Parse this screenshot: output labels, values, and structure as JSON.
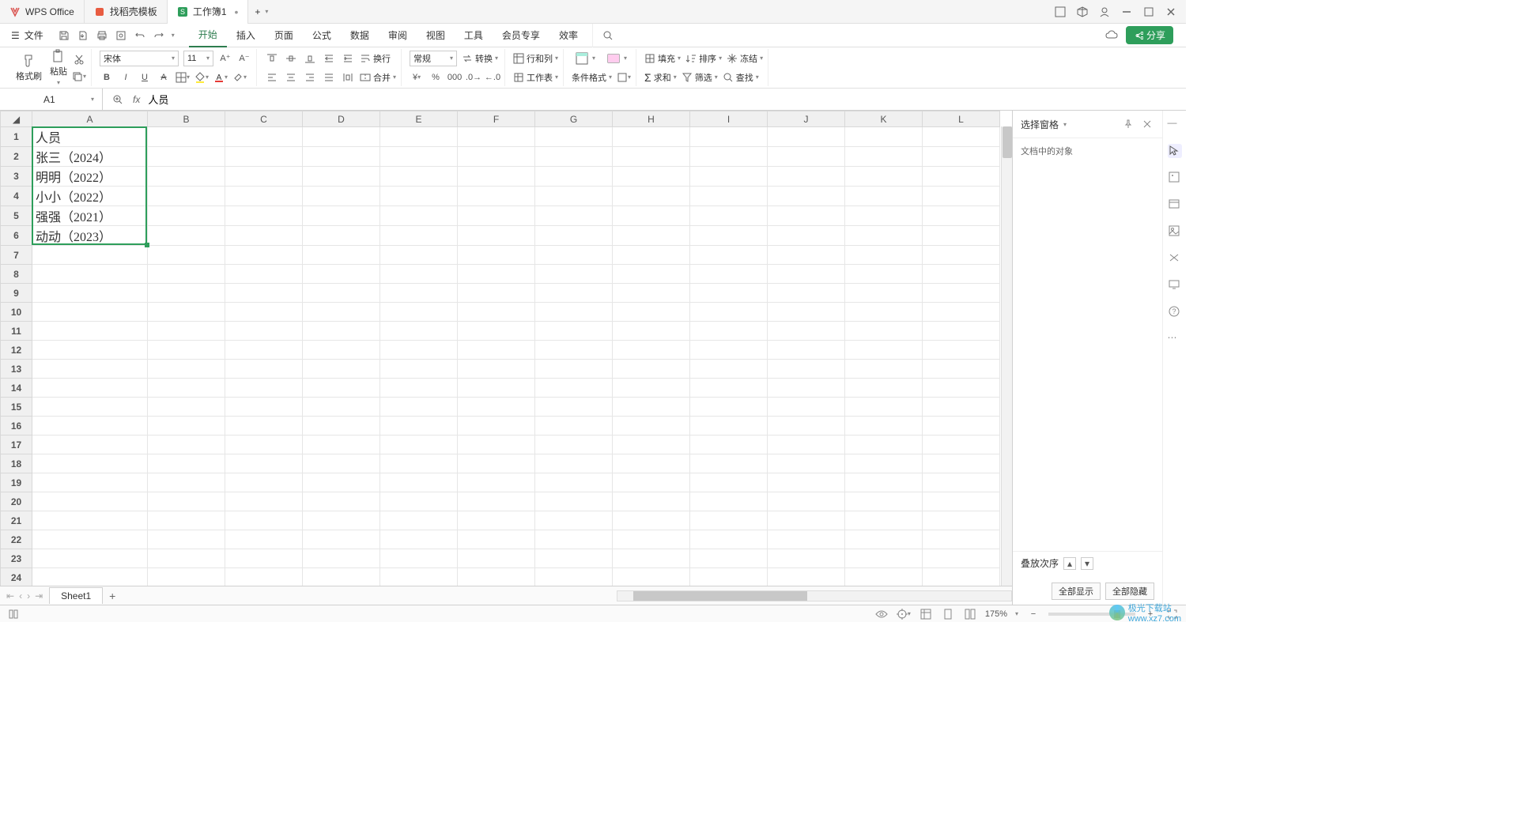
{
  "titlebar": {
    "tabs": [
      {
        "icon": "wps-logo-icon",
        "label": "WPS Office",
        "iconColor": "#d9534f"
      },
      {
        "icon": "template-icon",
        "label": "找稻壳模板",
        "iconColor": "#e85c41"
      },
      {
        "icon": "sheet-icon",
        "label": "工作簿1",
        "iconColor": "#2e9e5b",
        "active": true,
        "dirty": "•"
      }
    ],
    "addTab": "+"
  },
  "menubar": {
    "file": "文件",
    "tabs": [
      "开始",
      "插入",
      "页面",
      "公式",
      "数据",
      "审阅",
      "视图",
      "工具",
      "会员专享",
      "效率"
    ],
    "active": 0,
    "share": "分享"
  },
  "ribbon": {
    "formatBrush": "格式刷",
    "paste": "粘贴",
    "font": "宋体",
    "fontSize": "11",
    "wrap": "换行",
    "merge": "合并",
    "numFmt": "常规",
    "convert": "转换",
    "rowCol": "行和列",
    "worksheet": "工作表",
    "condFmt": "条件格式",
    "fill": "填充",
    "sort": "排序",
    "freeze": "冻结",
    "sum": "求和",
    "filter": "筛选",
    "find": "查找"
  },
  "formula": {
    "nameBox": "A1",
    "value": "人员"
  },
  "grid": {
    "columns": [
      "A",
      "B",
      "C",
      "D",
      "E",
      "F",
      "G",
      "H",
      "I",
      "J",
      "K",
      "L"
    ],
    "rowCount": 24,
    "cells": {
      "A1": "人员",
      "A2": "张三（2024）",
      "A3": "明明（2022）",
      "A4": "小小（2022）",
      "A5": "强强（2021）",
      "A6": "动动（2023）"
    },
    "selection": {
      "col": "A",
      "rowStart": 1,
      "rowEnd": 6
    }
  },
  "sidePanel": {
    "title": "选择窗格",
    "subtitle": "文档中的对象",
    "stackOrder": "叠放次序",
    "showAll": "全部显示",
    "hideAll": "全部隐藏"
  },
  "sheetTabs": {
    "sheets": [
      "Sheet1"
    ],
    "add": "+"
  },
  "statusbar": {
    "zoom": "175%"
  },
  "watermark": "极光下载站\nwww.xz7.com"
}
